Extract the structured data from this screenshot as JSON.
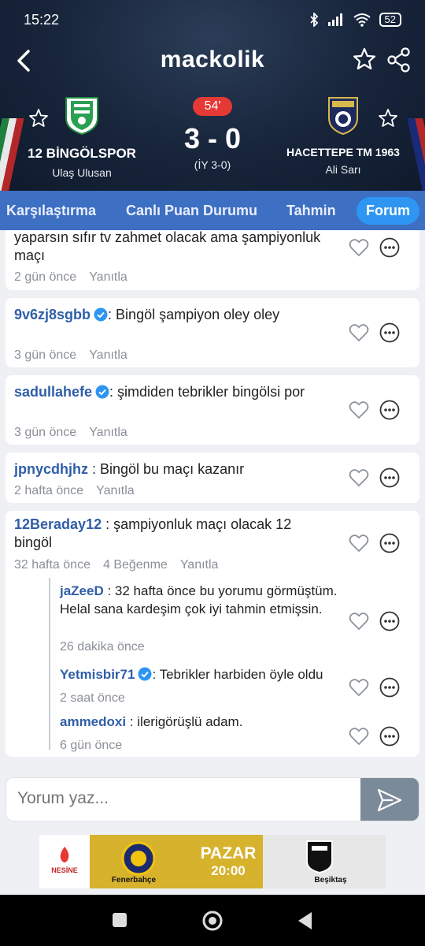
{
  "status": {
    "time": "15:22",
    "battery": "52"
  },
  "app": {
    "brand": "mackolik"
  },
  "match": {
    "minute": "54'",
    "score": "3 - 0",
    "halftime": "(İY 3-0)",
    "home": {
      "name": "12 BİNGÖLSPOR",
      "coach": "Ulaş Ulusan"
    },
    "away": {
      "name": "HACETTEPE TM 1963",
      "coach": "Ali Sarı"
    }
  },
  "tabs": [
    "Karşılaştırma",
    "Canlı Puan Durumu",
    "Tahmin",
    "Forum"
  ],
  "comments": [
    {
      "user": "",
      "text": "yaparsın sıfır tv zahmet olacak ama şampiyonluk maçı",
      "time": "2 gün önce",
      "reply": "Yanıtla"
    },
    {
      "user": "9v6zj8sgbb",
      "text": ": Bingöl şampiyon oley oley",
      "time": "3 gün önce",
      "reply": "Yanıtla"
    },
    {
      "user": "sadullahefe",
      "text": ": şimdiden tebrikler bingölsi por",
      "time": "3 gün önce",
      "reply": "Yanıtla"
    },
    {
      "user": "jpnycdhjhz",
      "text": " : Bingöl bu maçı kazanır",
      "time": "2 hafta önce",
      "reply": "Yanıtla"
    },
    {
      "user": "12Beraday12",
      "text": " : şampiyonluk maçı olacak 12 bingöl",
      "time": "32 hafta önce",
      "likes": "4 Beğenme",
      "reply": "Yanıtla"
    }
  ],
  "replies": [
    {
      "user": "jaZeeD",
      "text": " : 32 hafta önce bu yorumu görmüştüm. Helal sana kardeşim çok iyi tahmin etmişsin.",
      "time": "26 dakika önce"
    },
    {
      "user": "Yetmisbir71",
      "text": ": Tebrikler harbiden öyle oldu",
      "time": "2 saat önce"
    },
    {
      "user": "ammedoxi",
      "text": " : ilerigörüşlü adam.",
      "time": "6 gün önce"
    }
  ],
  "composer": {
    "placeholder": "Yorum yaz..."
  },
  "ad": {
    "day": "PAZAR",
    "time": "20:00",
    "team1": "Fenerbahçe",
    "team2": "Beşiktaş",
    "sponsor": "NESİNE"
  },
  "colors": {
    "accent": "#2e96f2",
    "tabbar": "#3d6fc2",
    "username": "#2f5ea8",
    "live": "#e53935"
  }
}
